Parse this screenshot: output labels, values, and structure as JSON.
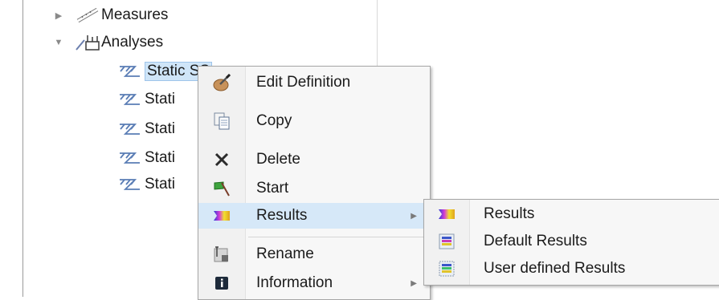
{
  "tree": {
    "measures_label": "Measures",
    "analyses_label": "Analyses",
    "children": [
      {
        "label": "Static SS",
        "selected": true
      },
      {
        "label": "Stati"
      },
      {
        "label": "Stati"
      },
      {
        "label": "Stati"
      },
      {
        "label": "Stati"
      }
    ]
  },
  "context_menu": {
    "items": [
      {
        "label": "Edit Definition",
        "icon": "edit-icon"
      },
      {
        "label": "Copy",
        "icon": "copy-icon"
      },
      {
        "label": "Delete",
        "icon": "delete-icon"
      },
      {
        "label": "Start",
        "icon": "start-flag-icon"
      },
      {
        "label": "Results",
        "icon": "results-icon",
        "submenu": true,
        "highlighted": true
      },
      {
        "label": "Rename",
        "icon": "rename-icon"
      },
      {
        "label": "Information",
        "icon": "info-icon",
        "submenu": true
      }
    ]
  },
  "results_submenu": {
    "items": [
      {
        "label": "Results",
        "icon": "results-icon"
      },
      {
        "label": "Default Results",
        "icon": "default-results-icon"
      },
      {
        "label": "User defined Results",
        "icon": "user-defined-results-icon"
      }
    ]
  },
  "colors": {
    "selection": "#cfe5f8",
    "menu_highlight": "#d6e8f8",
    "menu_bg": "#f7f7f7"
  }
}
